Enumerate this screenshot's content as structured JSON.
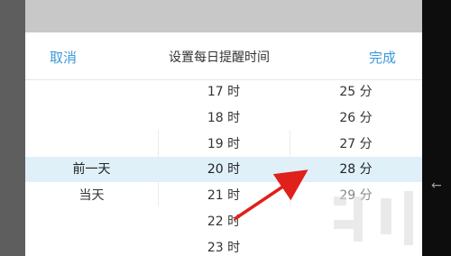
{
  "dialog": {
    "cancel_label": "取消",
    "title": "设置每日提醒时间",
    "done_label": "完成"
  },
  "picker": {
    "day_column": [
      "前一天",
      "当天"
    ],
    "hour_column": [
      "17 时",
      "18 时",
      "19 时",
      "20 时",
      "21 时",
      "22 时",
      "23 时"
    ],
    "minute_column": [
      "25 分",
      "26 分",
      "27 分",
      "28 分",
      "29 分"
    ],
    "selected": {
      "day": "前一天",
      "hour": "20 时",
      "minute": "28 分"
    }
  },
  "colors": {
    "accent": "#3a9ad9",
    "selection_band": "#dff0f9",
    "annotation_arrow": "#e0201b"
  },
  "system": {
    "back_icon": "back-arrow-icon"
  }
}
